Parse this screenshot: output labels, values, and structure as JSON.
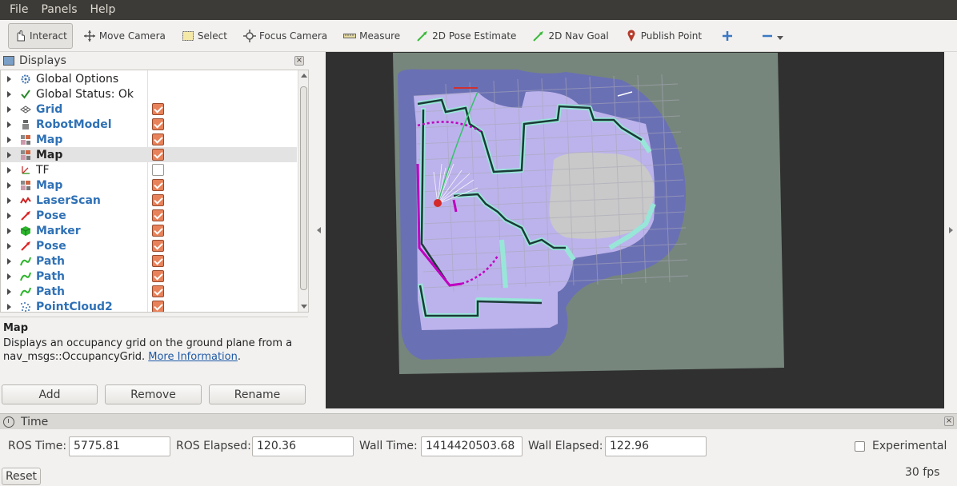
{
  "menubar": {
    "items": [
      "File",
      "Panels",
      "Help"
    ]
  },
  "toolbar": {
    "tools": [
      {
        "label": "Interact",
        "icon": "hand-icon"
      },
      {
        "label": "Move Camera",
        "icon": "move-camera-icon"
      },
      {
        "label": "Select",
        "icon": "select-icon"
      },
      {
        "label": "Focus Camera",
        "icon": "focus-camera-icon"
      },
      {
        "label": "Measure",
        "icon": "ruler-icon"
      },
      {
        "label": "2D Pose Estimate",
        "icon": "pose-estimate-arrow-icon"
      },
      {
        "label": "2D Nav Goal",
        "icon": "nav-goal-arrow-icon"
      },
      {
        "label": "Publish Point",
        "icon": "map-pin-icon"
      }
    ],
    "add_icon": "plus-icon",
    "remove_icon": "minus-icon"
  },
  "displays": {
    "title": "Displays",
    "rows": [
      {
        "name": "Global Options",
        "icon": "gear-icon",
        "checked": null
      },
      {
        "name": "Global Status: Ok",
        "icon": "checkmark-icon",
        "checked": null
      },
      {
        "name": "Grid",
        "icon": "grid-icon",
        "checked": true
      },
      {
        "name": "RobotModel",
        "icon": "robot-icon",
        "checked": true
      },
      {
        "name": "Map",
        "icon": "map-icon",
        "checked": true
      },
      {
        "name": "Map",
        "icon": "map-icon",
        "checked": true
      },
      {
        "name": "TF",
        "icon": "tf-axes-icon",
        "checked": false
      },
      {
        "name": "Map",
        "icon": "map-icon",
        "checked": true
      },
      {
        "name": "LaserScan",
        "icon": "laserscan-icon",
        "checked": true
      },
      {
        "name": "Pose",
        "icon": "pose-arrow-icon",
        "checked": true
      },
      {
        "name": "Marker",
        "icon": "marker-cube-icon",
        "checked": true
      },
      {
        "name": "Pose",
        "icon": "pose-arrow-icon",
        "checked": true
      },
      {
        "name": "Path",
        "icon": "path-icon",
        "checked": true
      },
      {
        "name": "Path",
        "icon": "path-icon",
        "checked": true
      },
      {
        "name": "Path",
        "icon": "path-icon",
        "checked": true
      },
      {
        "name": "PointCloud2",
        "icon": "pointcloud-icon",
        "checked": true
      }
    ],
    "selected_index": 5,
    "description": {
      "title": "Map",
      "text": "Displays an occupancy grid on the ground plane from a nav_msgs::OccupancyGrid.",
      "link": "More Information",
      "after_link": "."
    },
    "buttons": {
      "add": "Add",
      "remove": "Remove",
      "rename": "Rename"
    }
  },
  "time": {
    "title": "Time",
    "ros_time_label": "ROS Time:",
    "ros_time": "5775.81",
    "ros_elapsed_label": "ROS Elapsed:",
    "ros_elapsed": "120.36",
    "wall_time_label": "Wall Time:",
    "wall_time": "1414420503.68",
    "wall_elapsed_label": "Wall Elapsed:",
    "wall_elapsed": "122.96",
    "experimental_label": "Experimental"
  },
  "status": {
    "reset_label": "Reset",
    "fps": "30 fps"
  },
  "colors": {
    "menubar_bg": "#3c3b37",
    "checkbox_checked": "#e8825a",
    "link": "#1f59a6",
    "display_name_blue": "#2f71b6",
    "viewport_bg": "#303030",
    "map_unknown": "#76867c",
    "costmap_blue": "#6a70b4",
    "costmap_lavender": "#bcb3ec",
    "obstacle_cyan": "#98e6d8",
    "path_magenta": "#c000c0",
    "laser_white": "#ffffff",
    "nav_path_green": "#35c26a"
  }
}
